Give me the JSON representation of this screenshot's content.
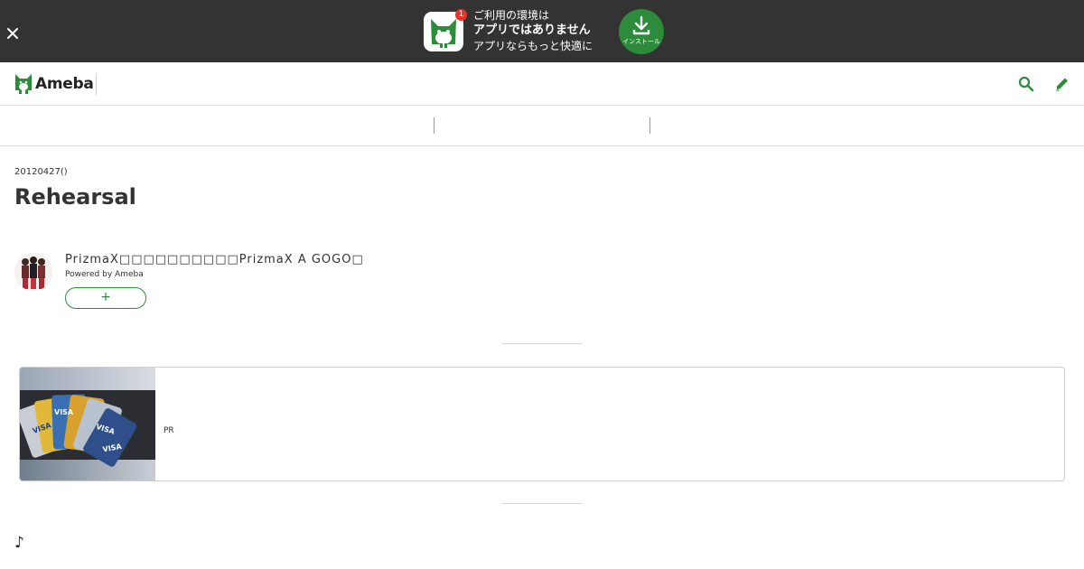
{
  "app_banner": {
    "badge_count": "1",
    "line1": "ご利用の環境は",
    "line2": "アプリではありません",
    "line3": "アプリならもっと快適に",
    "install_label": "インストール",
    "icons": {
      "close": "close-icon",
      "app": "ameba-app-icon",
      "install": "download-icon"
    }
  },
  "header": {
    "logo_text": "Ameba",
    "icons": {
      "search": "search-icon",
      "edit": "pencil-icon"
    }
  },
  "article": {
    "date": "20120427()",
    "title": "Rehearsal",
    "author_name": "PrizmaX□□□□□□□□□□PrizmaX A GOGO□",
    "powered_by": "Powered by Ameba",
    "follow_label": "+"
  },
  "ad": {
    "label": "PR"
  },
  "body_start": "♪",
  "colors": {
    "banner_bg": "#333333",
    "accent_green": "#2d8c3c",
    "badge_red": "#e5322d"
  }
}
